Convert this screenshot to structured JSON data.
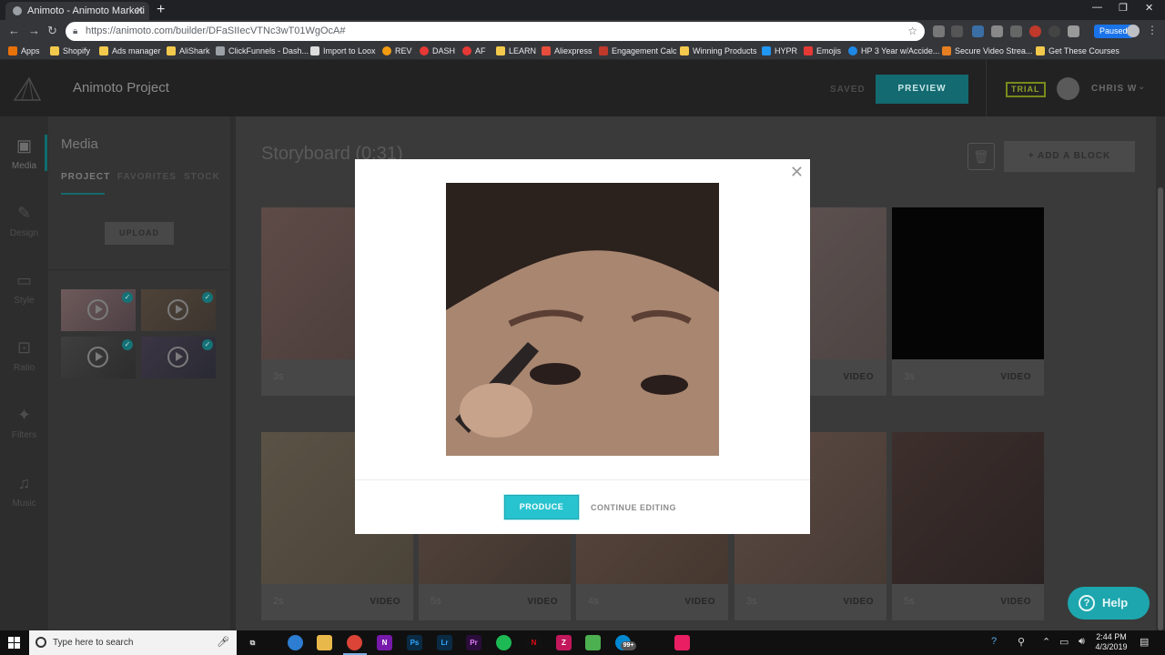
{
  "browser": {
    "tab_title": "Animoto - Animoto Marketi",
    "url": "https://animoto.com/builder/DFaSIIecVTNc3wT01WgOcA#",
    "paused_label": "Paused",
    "bookmarks": [
      "Apps",
      "Shopify",
      "Ads manager",
      "AliShark",
      "ClickFunnels - Dash...",
      "Import to Loox",
      "REV",
      "DASH",
      "AF",
      "LEARN",
      "Aliexpress",
      "Engagement Calc",
      "Winning Products",
      "HYPR",
      "Emojis",
      "HP 3 Year w/Accide...",
      "Secure Video Strea...",
      "Get These Courses"
    ]
  },
  "header": {
    "project_title": "Animoto Project",
    "saved_label": "SAVED",
    "preview_label": "PREVIEW",
    "trial_label": "TRIAL",
    "user_name": "CHRIS W"
  },
  "rail": {
    "items": [
      {
        "label": "Media",
        "icon": "image-icon"
      },
      {
        "label": "Design",
        "icon": "brush-icon"
      },
      {
        "label": "Style",
        "icon": "style-icon"
      },
      {
        "label": "Ratio",
        "icon": "ratio-icon"
      },
      {
        "label": "Filters",
        "icon": "wand-icon"
      },
      {
        "label": "Music",
        "icon": "music-note-icon"
      }
    ]
  },
  "media_panel": {
    "title": "Media",
    "tabs": [
      "PROJECT",
      "FAVORITES",
      "STOCK"
    ],
    "upload_label": "UPLOAD"
  },
  "storyboard": {
    "title": "Storyboard (0:31)",
    "add_block_label": "ADD A BLOCK",
    "cards": [
      {
        "duration": "3s",
        "type": ""
      },
      {
        "duration": "",
        "type": "VIDEO"
      },
      {
        "duration": "3s",
        "type": "VIDEO"
      },
      {
        "duration": "2s",
        "type": "VIDEO"
      },
      {
        "duration": "5s",
        "type": "VIDEO"
      },
      {
        "duration": "4s",
        "type": "VIDEO"
      },
      {
        "duration": "3s",
        "type": "VIDEO"
      },
      {
        "duration": "5s",
        "type": "VIDEO"
      }
    ]
  },
  "modal": {
    "produce_label": "PRODUCE",
    "continue_label": "CONTINUE EDITING"
  },
  "help": {
    "label": "Help"
  },
  "taskbar": {
    "search_placeholder": "Type here to search",
    "time": "2:44 PM",
    "date": "4/3/2019",
    "badge": "99+"
  }
}
